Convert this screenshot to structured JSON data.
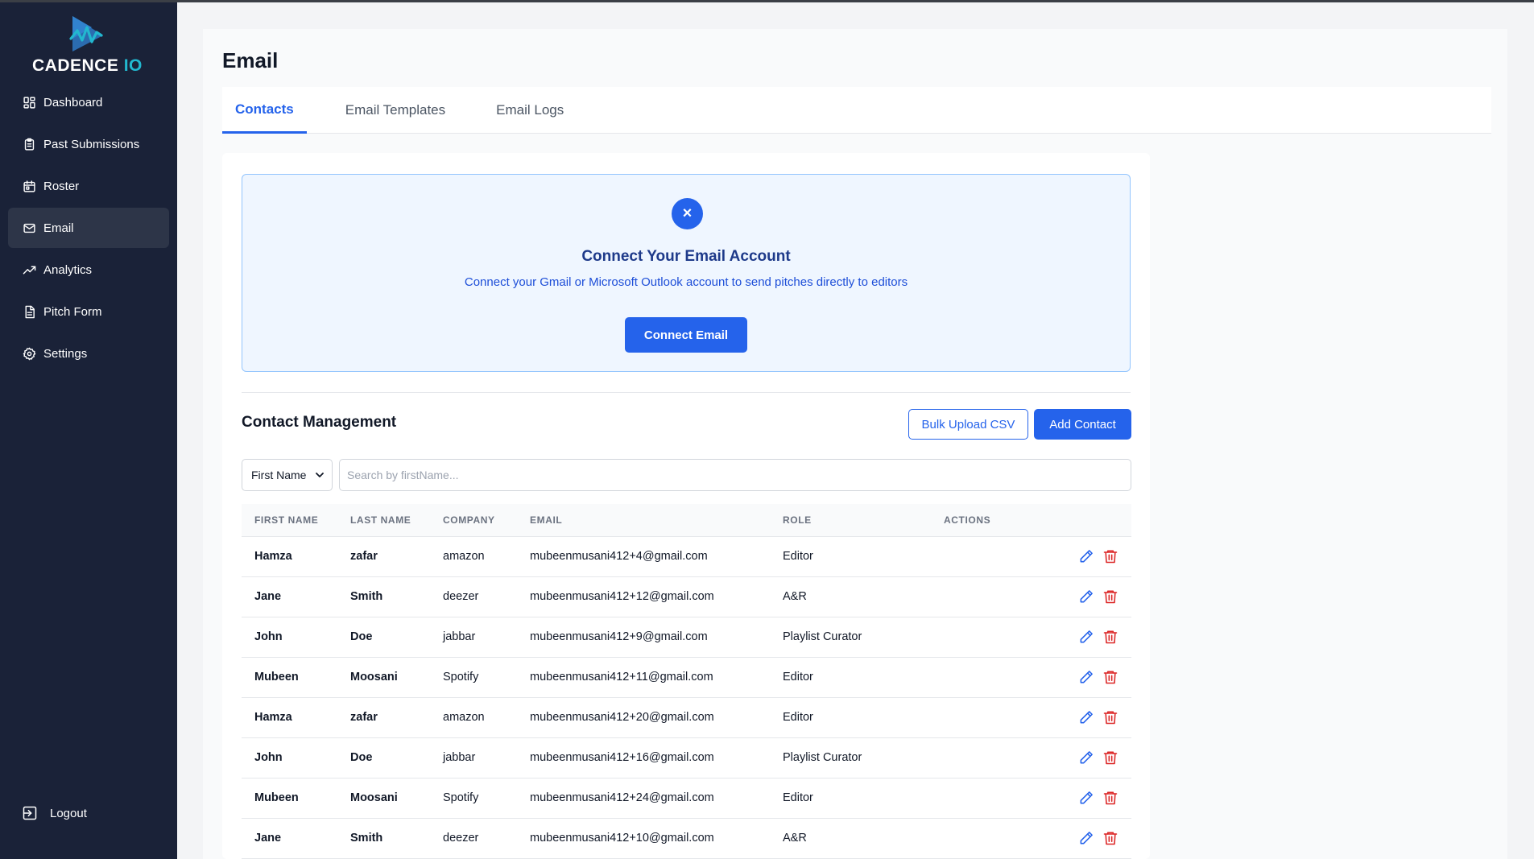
{
  "brand": {
    "name_main": "CADENCE",
    "name_accent": "IO",
    "accent_color": "#22b8cf",
    "primary_color": "#2563eb",
    "sidebar_bg": "#1a2238"
  },
  "sidebar": {
    "items": [
      {
        "label": "Dashboard",
        "icon": "dashboard-icon"
      },
      {
        "label": "Past Submissions",
        "icon": "clipboard-icon"
      },
      {
        "label": "Roster",
        "icon": "calendar-icon"
      },
      {
        "label": "Email",
        "icon": "mail-icon",
        "active": true
      },
      {
        "label": "Analytics",
        "icon": "trending-up-icon"
      },
      {
        "label": "Pitch Form",
        "icon": "document-icon"
      },
      {
        "label": "Settings",
        "icon": "gear-icon"
      }
    ],
    "logout_label": "Logout"
  },
  "page": {
    "title": "Email",
    "tabs": [
      {
        "label": "Contacts",
        "active": true
      },
      {
        "label": "Email Templates"
      },
      {
        "label": "Email Logs"
      }
    ]
  },
  "connect": {
    "icon": "close-icon",
    "icon_glyph": "×",
    "title": "Connect Your Email Account",
    "description": "Connect your Gmail or Microsoft Outlook account to send pitches directly to editors",
    "button_label": "Connect Email"
  },
  "contacts": {
    "title": "Contact Management",
    "bulk_upload_label": "Bulk Upload CSV",
    "add_contact_label": "Add Contact",
    "filter_selected": "First Name",
    "search_placeholder": "Search by firstName...",
    "columns": [
      "FIRST NAME",
      "LAST NAME",
      "COMPANY",
      "EMAIL",
      "ROLE",
      "ACTIONS"
    ],
    "rows": [
      {
        "first": "Hamza",
        "last": "zafar",
        "company": "amazon",
        "email": "mubeenmusani412+4@gmail.com",
        "role": "Editor"
      },
      {
        "first": "Jane",
        "last": "Smith",
        "company": "deezer",
        "email": "mubeenmusani412+12@gmail.com",
        "role": "A&R"
      },
      {
        "first": "John",
        "last": "Doe",
        "company": "jabbar",
        "email": "mubeenmusani412+9@gmail.com",
        "role": "Playlist Curator"
      },
      {
        "first": "Mubeen",
        "last": "Moosani",
        "company": "Spotify",
        "email": "mubeenmusani412+11@gmail.com",
        "role": "Editor"
      },
      {
        "first": "Hamza",
        "last": "zafar",
        "company": "amazon",
        "email": "mubeenmusani412+20@gmail.com",
        "role": "Editor"
      },
      {
        "first": "John",
        "last": "Doe",
        "company": "jabbar",
        "email": "mubeenmusani412+16@gmail.com",
        "role": "Playlist Curator"
      },
      {
        "first": "Mubeen",
        "last": "Moosani",
        "company": "Spotify",
        "email": "mubeenmusani412+24@gmail.com",
        "role": "Editor"
      },
      {
        "first": "Jane",
        "last": "Smith",
        "company": "deezer",
        "email": "mubeenmusani412+10@gmail.com",
        "role": "A&R"
      }
    ]
  }
}
